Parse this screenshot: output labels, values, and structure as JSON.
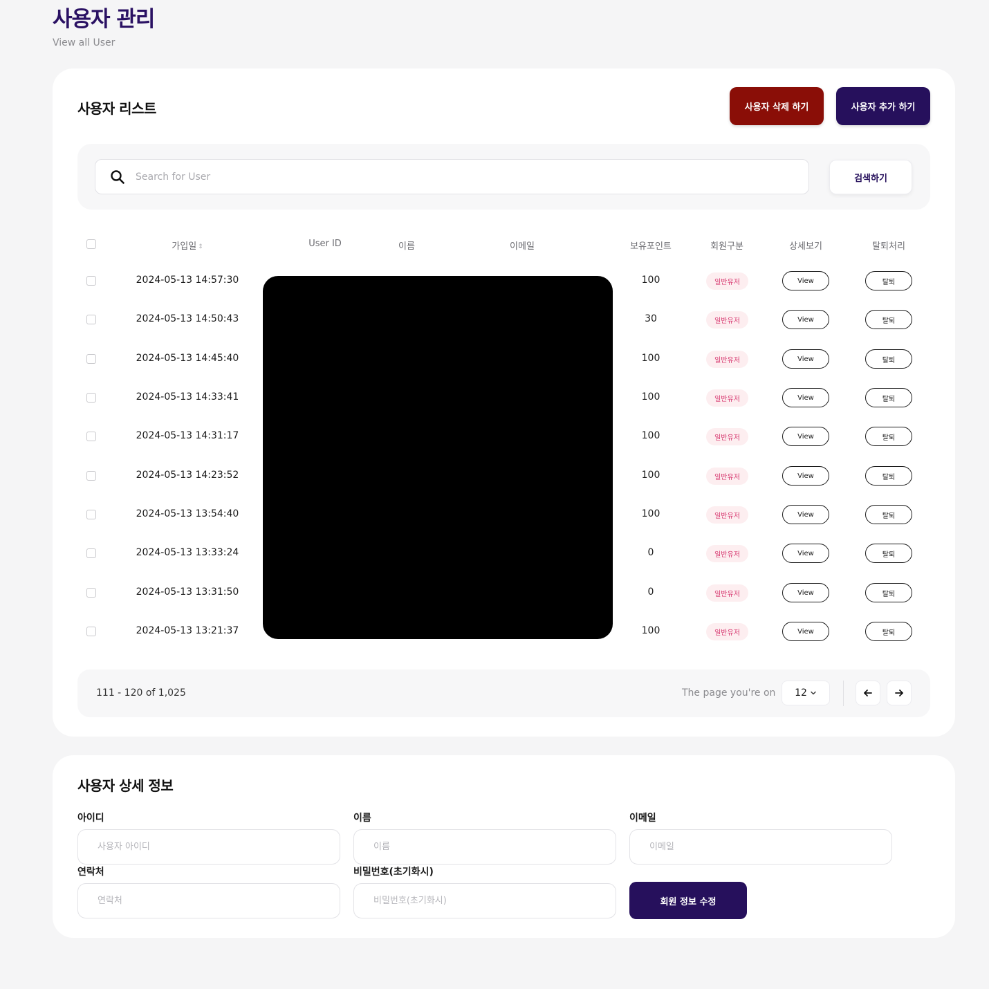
{
  "header": {
    "title": "사용자 관리",
    "subtitle": "View all User"
  },
  "list": {
    "title": "사용자 리스트",
    "delete_label": "사용자 삭제 하기",
    "add_label": "사용자 추가 하기",
    "search": {
      "placeholder": "Search for User",
      "button_label": "검색하기"
    },
    "columns": {
      "joined": "가입일",
      "user_id": "User ID",
      "name": "이름",
      "email": "이메일",
      "points": "보유포인트",
      "member_type": "회원구분",
      "detail": "상세보기",
      "withdraw": "탈퇴처리"
    },
    "rows": [
      {
        "joined": "2024-05-13 14:57:30",
        "points": "100",
        "member_type": "일반유저",
        "view_label": "View",
        "withdraw_label": "탈퇴"
      },
      {
        "joined": "2024-05-13 14:50:43",
        "points": "30",
        "member_type": "일반유저",
        "view_label": "View",
        "withdraw_label": "탈퇴"
      },
      {
        "joined": "2024-05-13 14:45:40",
        "points": "100",
        "member_type": "일반유저",
        "view_label": "View",
        "withdraw_label": "탈퇴"
      },
      {
        "joined": "2024-05-13 14:33:41",
        "points": "100",
        "member_type": "일반유저",
        "view_label": "View",
        "withdraw_label": "탈퇴"
      },
      {
        "joined": "2024-05-13 14:31:17",
        "points": "100",
        "member_type": "일반유저",
        "view_label": "View",
        "withdraw_label": "탈퇴"
      },
      {
        "joined": "2024-05-13 14:23:52",
        "points": "100",
        "member_type": "일반유저",
        "view_label": "View",
        "withdraw_label": "탈퇴"
      },
      {
        "joined": "2024-05-13 13:54:40",
        "points": "100",
        "member_type": "일반유저",
        "view_label": "View",
        "withdraw_label": "탈퇴"
      },
      {
        "joined": "2024-05-13 13:33:24",
        "points": "0",
        "member_type": "일반유저",
        "view_label": "View",
        "withdraw_label": "탈퇴"
      },
      {
        "joined": "2024-05-13 13:31:50",
        "points": "0",
        "member_type": "일반유저",
        "view_label": "View",
        "withdraw_label": "탈퇴"
      },
      {
        "joined": "2024-05-13 13:21:37",
        "points": "100",
        "member_type": "일반유저",
        "view_label": "View",
        "withdraw_label": "탈퇴"
      }
    ],
    "pagination": {
      "range": "111 - 120 of 1,025",
      "label": "The page you're on",
      "current_page": "12"
    }
  },
  "detail": {
    "title": "사용자 상세 정보",
    "fields": {
      "id": {
        "label": "아이디",
        "placeholder": "사용자 아이디"
      },
      "name": {
        "label": "이름",
        "placeholder": "이름"
      },
      "email": {
        "label": "이메일",
        "placeholder": "이메일"
      },
      "phone": {
        "label": "연락처",
        "placeholder": "연락처"
      },
      "password": {
        "label": "비밀번호(초기화시)",
        "placeholder": "비밀번호(초기화시)"
      }
    },
    "update_label": "회원 정보 수정"
  },
  "colors": {
    "brand": "#26105c",
    "danger": "#8a0e07",
    "badge_bg": "#fdeef0",
    "badge_text": "#d6336c",
    "page_bg": "#f5f5f6"
  },
  "icons": {
    "search": "search-icon",
    "page_dropdown": "chevron-down-icon",
    "prev": "arrow-left-icon",
    "next": "arrow-right-icon",
    "sort": "sort-icon"
  }
}
